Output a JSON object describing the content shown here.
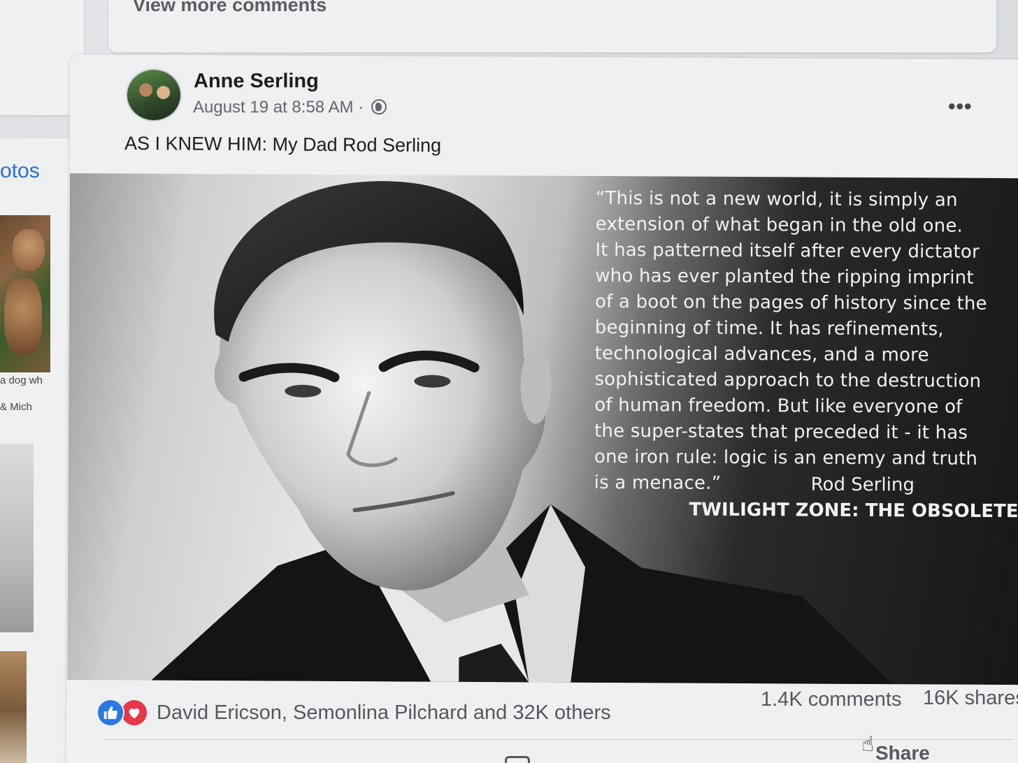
{
  "comments_card": {
    "view_more": "View more comments"
  },
  "photos": {
    "title": "otos",
    "captions": [
      "a dog wh",
      "& Mich"
    ]
  },
  "post": {
    "author": "Anne Serling",
    "timestamp": "August 19 at 8:58 AM ·",
    "text": "AS I KNEW HIM: My Dad Rod Serling",
    "more_icon": "•••",
    "image": {
      "quote_lines": [
        "“This is not a new world,  it is simply an",
        "extension of what began in the old one.",
        "It has patterned itself after every dictator",
        "who has ever planted the ripping imprint",
        "of a boot on the pages of history since the",
        "beginning of time. It has refinements,",
        "technological  advances, and a more",
        "sophisticated approach to the destruction",
        "of human freedom. But like everyone of",
        "the super-states that preceded it - it has",
        "one iron rule: logic is an enemy and truth",
        "is a menace.”"
      ],
      "signature": "Rod Serling",
      "source": "TWILIGHT ZONE: THE OBSOLETE MAN"
    },
    "reactions": {
      "names": "David Ericson, Semonlina Pilchard and 32K others",
      "comments": "1.4K comments",
      "shares": "16K shares",
      "like_color": "#2a78e4",
      "love_color": "#e8364a"
    },
    "actions": {
      "share": "Share"
    }
  }
}
